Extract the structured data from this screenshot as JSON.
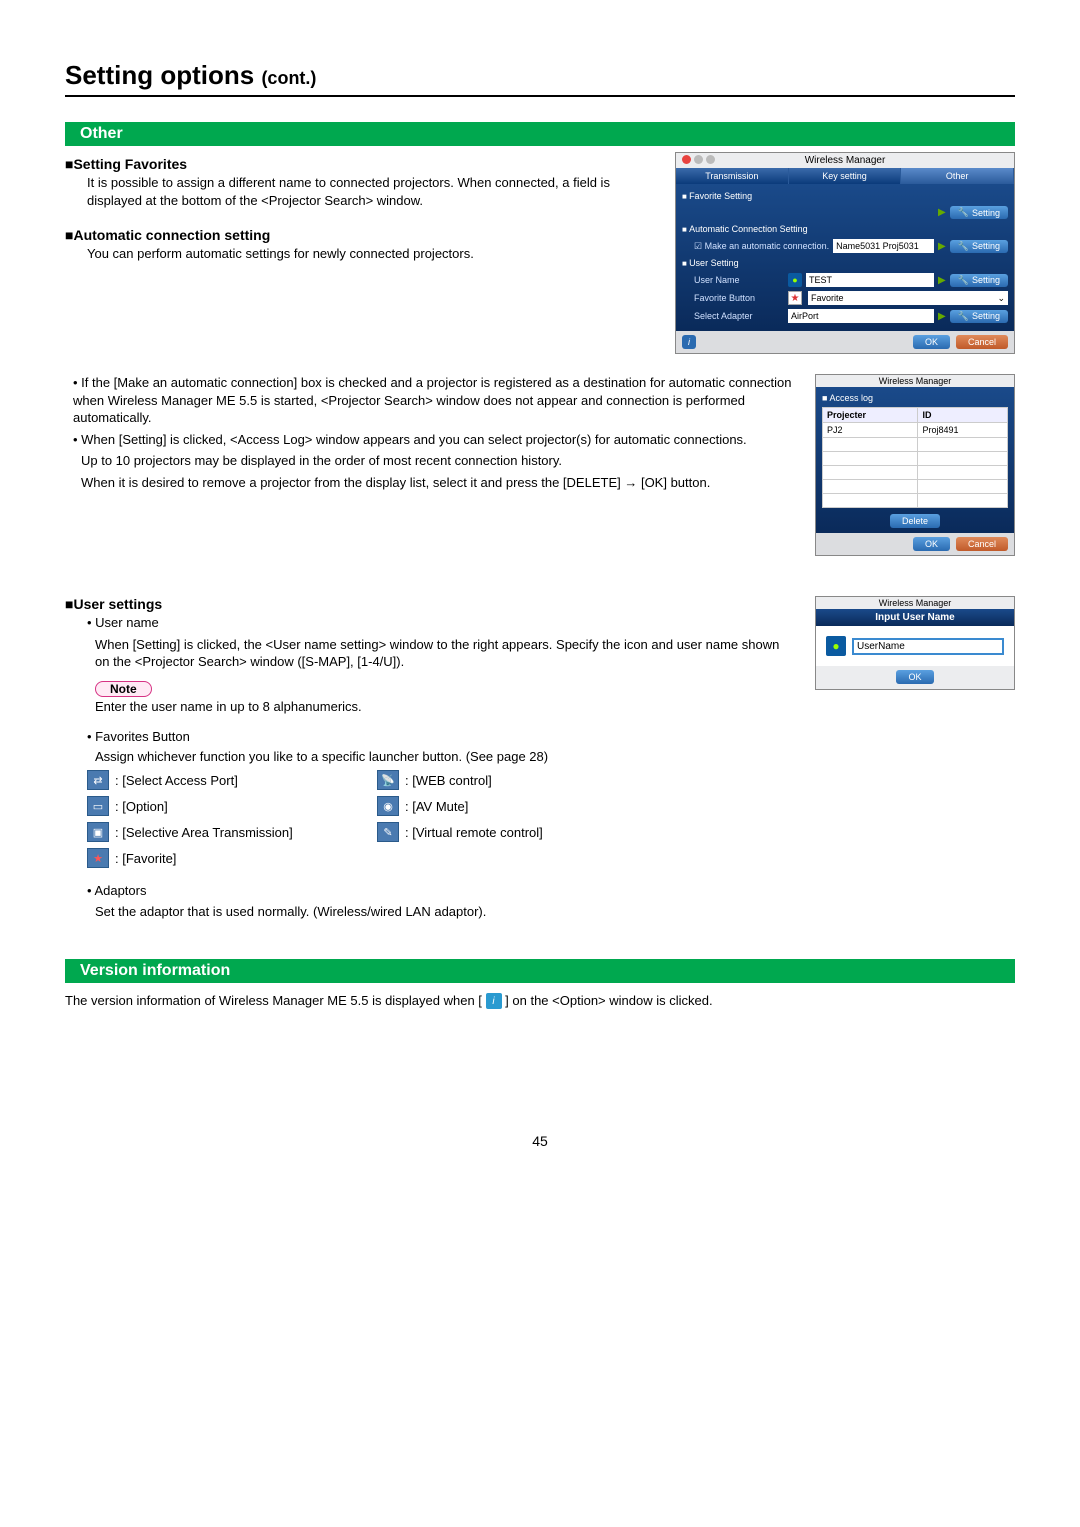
{
  "page": {
    "title": "Setting options",
    "cont": "(cont.)",
    "number": "45"
  },
  "section_other": "Other",
  "favorites": {
    "heading": "Setting Favorites",
    "text": "It is possible to assign a different name to connected projectors. When connected, a field is displayed at the bottom of the <Projector Search> window."
  },
  "auto": {
    "heading": "Automatic connection setting",
    "text": "You can perform automatic settings for newly connected projectors."
  },
  "bullets": {
    "b1": "• If the [Make an automatic connection] box is checked and a projector is registered as a destination for automatic connection when Wireless Manager ME 5.5 is started, <Projector Search> window does not appear and connection is performed automatically.",
    "b2": "• When [Setting] is clicked, <Access Log> window appears and you can select projector(s) for automatic connections.",
    "b3": "Up to 10 projectors may be displayed in the order of most recent connection history.",
    "b4": "When it is desired to remove a projector from the display list, select it and press the [DELETE] → [OK] button."
  },
  "user": {
    "heading": "User settings",
    "name_label": "• User name",
    "name_text": "When [Setting] is clicked, the <User name setting> window to the right appears. Specify the icon and user name shown on the <Projector Search> window ([S-MAP], [1-4/U]).",
    "note_badge": "Note",
    "note_text": "Enter the user name in up to 8 alphanumerics.",
    "fav_label": "• Favorites Button",
    "fav_text": "Assign whichever function you like to a specific launcher button. (See page 28)",
    "adapt_label": "• Adaptors",
    "adapt_text": "Set the adaptor that is used normally. (Wireless/wired LAN adaptor)."
  },
  "launcher": {
    "i1": ": [Select Access Port]",
    "i2": ": [WEB control]",
    "i3": ": [Option]",
    "i4": ": [AV Mute]",
    "i5": ": [Selective Area Transmission]",
    "i6": ": [Virtual remote control]",
    "i7": ": [Favorite]"
  },
  "version": {
    "heading": "Version information",
    "pre": "The version information of Wireless Manager ME 5.5 is displayed when [",
    "post": "] on the <Option> window is clicked."
  },
  "wm": {
    "title": "Wireless Manager",
    "tabs": {
      "t1": "Transmission",
      "t2": "Key setting",
      "t3": "Other"
    },
    "sec_fav": "Favorite Setting",
    "sec_auto": "Automatic Connection Setting",
    "auto_chk": "Make an automatic connection.",
    "auto_val": "Name5031 Proj5031",
    "sec_user": "User Setting",
    "row_user": "User Name",
    "row_user_val": "TEST",
    "row_fav": "Favorite Button",
    "row_fav_val": "Favorite",
    "row_adapt": "Select Adapter",
    "row_adapt_val": "AirPort",
    "btn_setting": "Setting",
    "btn_ok": "OK",
    "btn_cancel": "Cancel"
  },
  "al": {
    "title": "Wireless Manager",
    "sec": "Access log",
    "th1": "Projecter",
    "th2": "ID",
    "r1c1": "PJ2",
    "r1c2": "Proj8491",
    "del": "Delete",
    "ok": "OK",
    "cancel": "Cancel"
  },
  "iu": {
    "title": "Wireless Manager",
    "head": "Input User Name",
    "val": "UserName",
    "ok": "OK"
  }
}
